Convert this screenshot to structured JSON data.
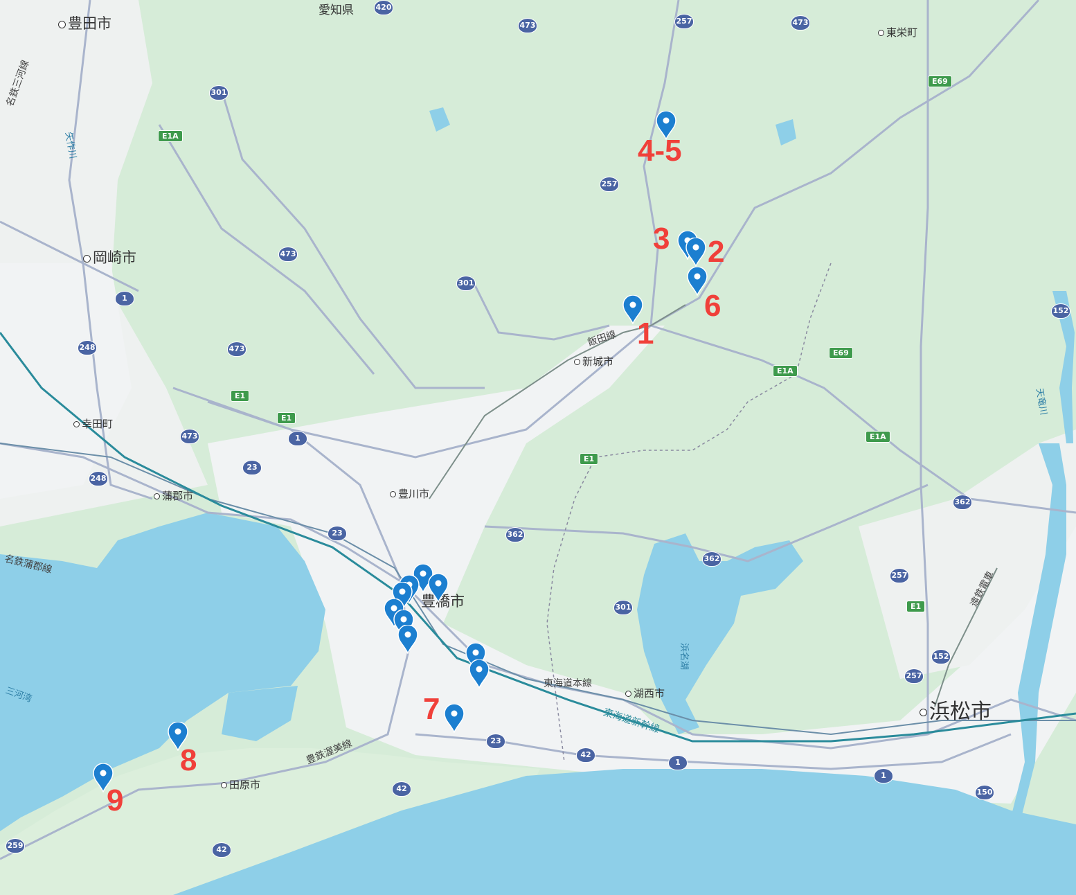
{
  "colors": {
    "land": "#d6ecd8",
    "urban": "#f1f3f4",
    "sea": "#8ecfe8",
    "road": "#a9b4cc",
    "pin": "#1c7fd0",
    "number": "#f0403a"
  },
  "cities": {
    "toyota": "豊田市",
    "okazaki": "岡崎市",
    "kota": "幸田町",
    "gamagori": "蒲郡市",
    "toyokawa": "豊川市",
    "toyohashi": "豊橋市",
    "shinshiro": "新城市",
    "kosai": "湖西市",
    "tahara": "田原市",
    "hamamatsu": "浜松市",
    "toei": "東栄町",
    "aichi": "愛知県"
  },
  "rail_lines": {
    "iida": "飯田線",
    "tokaido_main": "東海道本線",
    "shinkansen": "東海道新幹線",
    "atsumi": "豊鉄渥美線",
    "gamagori_line": "名鉄蒲郡線",
    "mikawa_line": "名鉄三河線",
    "enshu": "遠鉄電車"
  },
  "water": {
    "mikawa_bay": "三河湾",
    "hamana": "浜名湖",
    "yahagi": "矢作川",
    "tenryu": "天竜川"
  },
  "route_shields": {
    "r420": "420",
    "r473a": "473",
    "r257a": "257",
    "r473b": "473",
    "e69a": "E69",
    "r301a": "301",
    "e1a_a": "E1A",
    "r257b": "257",
    "r473c": "473",
    "r301b": "301",
    "r1a": "1",
    "r248a": "248",
    "r473d": "473",
    "e69b": "E69",
    "e1a_b": "E1A",
    "r152a": "152",
    "e1a": "E1",
    "e1b": "E1",
    "r1b": "1",
    "r473e": "473",
    "r23a": "23",
    "e1a_c": "E1A",
    "r248b": "248",
    "e1c": "E1",
    "r362a": "362",
    "r23b": "23",
    "r362b": "362",
    "r362c": "362",
    "r257c": "257",
    "r301c": "301",
    "e1d": "E1",
    "r152b": "152",
    "r257d": "257",
    "r23c": "23",
    "r42a": "42",
    "r1c": "1",
    "r1d": "1",
    "r150": "150",
    "r42b": "42",
    "r42c": "42",
    "r259": "259"
  },
  "markers": {
    "m1": "1",
    "m2": "2",
    "m3": "3",
    "m45": "4-5",
    "m6": "6",
    "m7": "7",
    "m8": "8",
    "m9": "9"
  }
}
